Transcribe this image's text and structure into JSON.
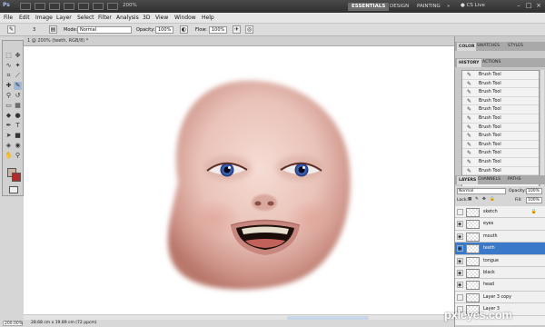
{
  "app": {
    "logo": "Ps",
    "zoom": "200%",
    "workspaces": [
      "ESSENTIALS",
      "DESIGN",
      "PAINTING",
      "»"
    ],
    "cs_live": "CS Live",
    "window_controls": [
      "–",
      "□",
      "×"
    ]
  },
  "menu": [
    "File",
    "Edit",
    "Image",
    "Layer",
    "Select",
    "Filter",
    "Analysis",
    "3D",
    "View",
    "Window",
    "Help"
  ],
  "options": {
    "brush_size": "3",
    "mode_label": "Mode:",
    "mode_value": "Normal",
    "opacity_label": "Opacity:",
    "opacity_value": "100%",
    "flow_label": "Flow:",
    "flow_value": "100%"
  },
  "document": {
    "tab_title": "1 @ 200% (teeth, RGB/8) *",
    "zoom": "200.00%",
    "info": "28.68 cm x 19.89 cm (72 ppcm)"
  },
  "colors": {
    "foreground": "#c9b59f",
    "background": "#b22a2a",
    "selection": "#3a78c9"
  },
  "panels": {
    "top_tabs": [
      "COLOR",
      "SWATCHES",
      "STYLES"
    ],
    "history_tabs": [
      "HISTORY",
      "ACTIONS"
    ],
    "history_items": [
      "Brush Tool",
      "Brush Tool",
      "Brush Tool",
      "Brush Tool",
      "Brush Tool",
      "Brush Tool",
      "Brush Tool",
      "Brush Tool",
      "Brush Tool",
      "Brush Tool",
      "Brush Tool",
      "Brush Tool",
      "Brush Tool"
    ],
    "history_selected_index": 12,
    "layers_tabs": [
      "LAYERS",
      "CHANNELS",
      "PATHS"
    ],
    "blend_mode": "Normal",
    "opacity_label": "Opacity:",
    "opacity_value": "100%",
    "lock_label": "Lock:",
    "fill_label": "Fill:",
    "fill_value": "100%",
    "layers": [
      {
        "name": "sketch",
        "visible": false,
        "locked": true
      },
      {
        "name": "eyes",
        "visible": true,
        "locked": false
      },
      {
        "name": "mouth",
        "visible": true,
        "locked": false
      },
      {
        "name": "teeth",
        "visible": true,
        "locked": false
      },
      {
        "name": "tongue",
        "visible": true,
        "locked": false
      },
      {
        "name": "black",
        "visible": true,
        "locked": false
      },
      {
        "name": "head",
        "visible": true,
        "locked": false
      },
      {
        "name": "Layer 3 copy",
        "visible": false,
        "locked": false
      },
      {
        "name": "Layer 3",
        "visible": false,
        "locked": false
      }
    ],
    "selected_layer_index": 3
  },
  "watermark": "pxleyes.com"
}
